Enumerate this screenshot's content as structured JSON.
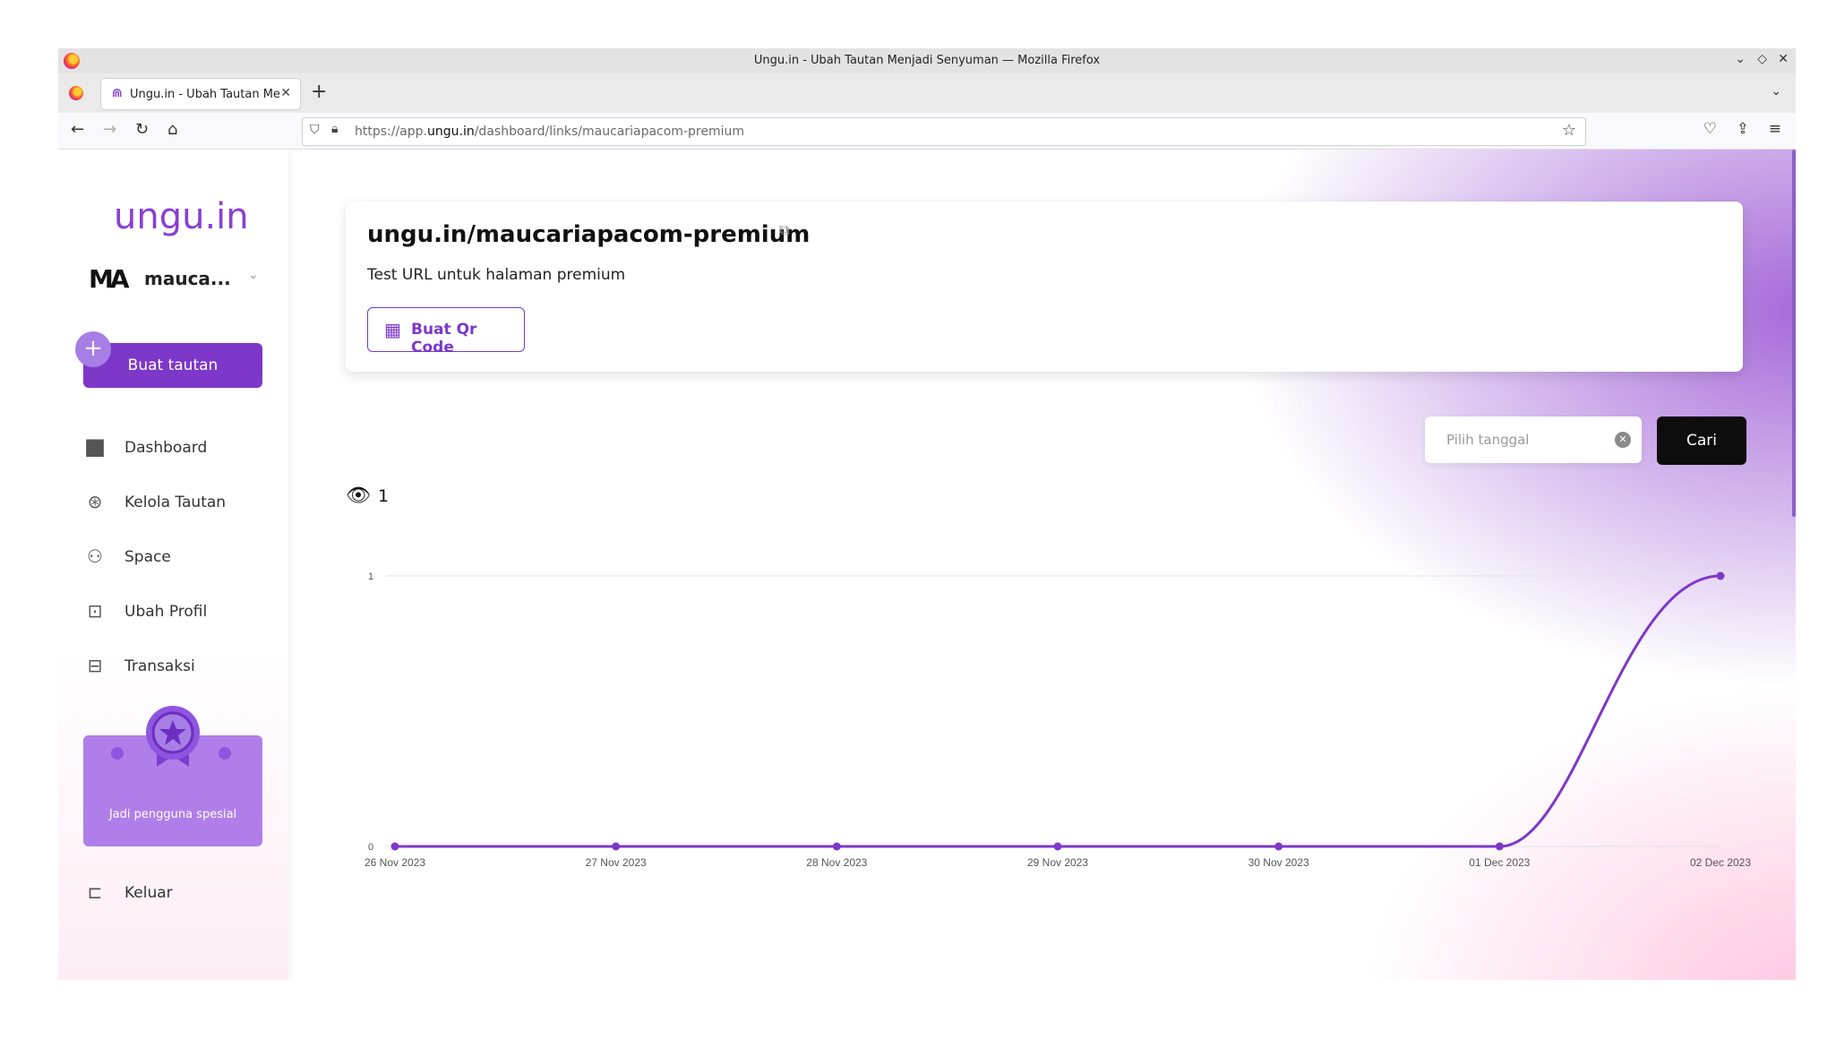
{
  "browser": {
    "window_title": "Ungu.in - Ubah Tautan Menjadi Senyuman — Mozilla Firefox",
    "tab_title": "Ungu.in - Ubah Tautan Menjadi Senyuman",
    "url_prefix": "https://app.",
    "url_domain": "ungu.in",
    "url_path": "/dashboard/links/maucariapacom-premium"
  },
  "sidebar": {
    "logo": "ungu.in",
    "workspace_logo": "MA",
    "workspace_name": "mauca...",
    "create_button": "Buat tautan",
    "menu": [
      {
        "label": "Dashboard",
        "icon": "home-icon"
      },
      {
        "label": "Kelola Tautan",
        "icon": "link-globe-icon"
      },
      {
        "label": "Space",
        "icon": "team-icon"
      },
      {
        "label": "Ubah Profil",
        "icon": "profile-edit-icon"
      },
      {
        "label": "Transaksi",
        "icon": "receipt-icon"
      }
    ],
    "special_card": "Jadi pengguna spesial",
    "logout": "Keluar"
  },
  "link": {
    "title": "ungu.in/maucariapacom-premium",
    "description": "Test URL untuk halaman premium",
    "qr_button": "Buat Qr Code"
  },
  "filter": {
    "date_placeholder": "Pilih tanggal",
    "search_button": "Cari"
  },
  "stats": {
    "views": "1"
  },
  "colors": {
    "accent": "#7d37c9",
    "line": "#7d37c9"
  },
  "chart_data": {
    "type": "line",
    "x": [
      "26 Nov 2023",
      "27 Nov 2023",
      "28 Nov 2023",
      "29 Nov 2023",
      "30 Nov 2023",
      "01 Dec 2023",
      "02 Dec 2023"
    ],
    "series": [
      {
        "values": [
          0,
          0,
          0,
          0,
          0,
          0,
          1
        ]
      }
    ],
    "yticks": [
      "0",
      "1"
    ],
    "ylim": [
      0,
      1
    ],
    "grid": true
  }
}
